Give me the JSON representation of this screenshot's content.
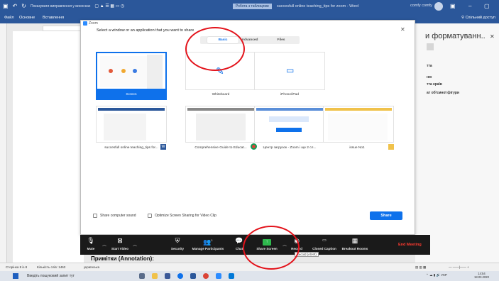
{
  "colors": {
    "word_blue": "#2b579a",
    "zoom_blue": "#0e71eb",
    "annotation_red": "#e3131b",
    "share_green": "#2eb84d"
  },
  "word": {
    "quick_access_text": "Показувати виправлення у виносках",
    "status_tag": "Робота з таблицями",
    "doc_title": "succesfull online teaching_tips for zoom - Word",
    "account": "comfy comfy",
    "ribbon_tabs": [
      "Файл",
      "Основне",
      "Вставлення"
    ],
    "share": "Спільний доступ",
    "side_panel_title": "и форматуванн..",
    "side_panel_lines": [
      "тта",
      "ню",
      "тта країв",
      "ат об'ємної фігури"
    ],
    "annotation": "Примітки (Annotation):",
    "status": {
      "page": "Сторінка 8 із 8",
      "words": "Кількість слів: 1463",
      "language": "українська"
    }
  },
  "dialog": {
    "app_name": "Zoom",
    "prompt": "Select a window or an application that you want to share",
    "tabs": [
      "Basic",
      "Advanced",
      "Files"
    ],
    "active_tab": "Basic",
    "tiles": [
      {
        "label": "Screen",
        "selected": true
      },
      {
        "label": "Whiteboard",
        "selected": false
      },
      {
        "label": "iPhone/iPad",
        "selected": false
      },
      {
        "label": "succesfull online teaching_tips for...",
        "selected": false
      },
      {
        "label": "Comprehensive Guide to Educat...",
        "selected": false
      },
      {
        "label": "Центр загрузок - Zoom і ще 2 сл...",
        "selected": false
      },
      {
        "label": "issue No1",
        "selected": false
      }
    ],
    "share_sound": "Share computer sound",
    "optimize": "Optimize Screen Sharing for Video Clip",
    "share_button": "Share"
  },
  "toolbar": {
    "mute": "Mute",
    "start_video": "Start Video",
    "security": "Security",
    "participants": "Manage Participants",
    "participants_count": "1",
    "chat": "Chat",
    "share_screen": "Share Screen",
    "record": "Record",
    "closed_caption": "Closed Caption",
    "breakout": "Breakout Rooms",
    "end": "End Meeting",
    "tooltip": "Record (Alt+R)"
  },
  "taskbar": {
    "search": "Введіть пошуковий запит тут",
    "lang": "УКР",
    "time": "14:54",
    "date": "18.03.2020"
  }
}
